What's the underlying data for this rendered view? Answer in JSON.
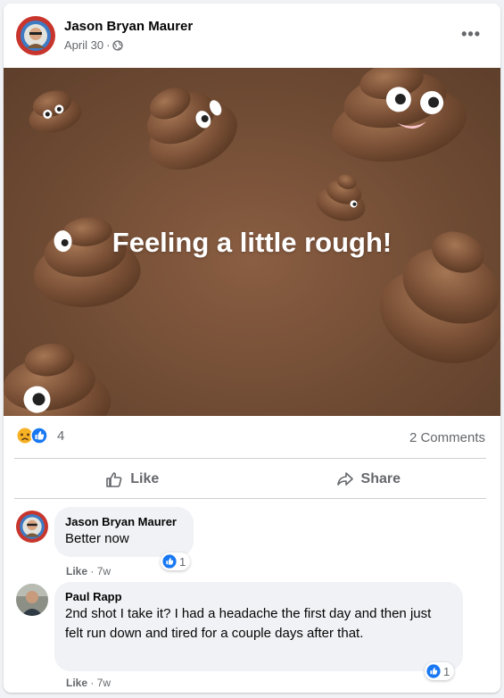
{
  "post": {
    "author": "Jason Bryan Maurer",
    "date": "April 30",
    "separator": "·",
    "audience_icon": "globe-icon",
    "more_label": "•••",
    "image_text": "Feeling a little rough!",
    "reaction_count": "4",
    "comment_count": "2 Comments",
    "reaction_icons": [
      "sad-reaction-icon",
      "like-reaction-icon"
    ]
  },
  "actions": {
    "like_label": "Like",
    "share_label": "Share"
  },
  "comments": [
    {
      "author": "Jason Bryan Maurer",
      "text": "Better now",
      "like_label": "Like",
      "time": "7w",
      "reaction_count": "1"
    },
    {
      "author": "Paul Rapp",
      "text": "2nd shot I take it? I had a headache the first day and then just felt run down and tired for a couple days after that.",
      "like_label": "Like",
      "time": "7w",
      "reaction_count": "1"
    }
  ],
  "colors": {
    "like_blue": "#1877f2",
    "sad_yellow": "#f7b125",
    "text_secondary": "#65676b"
  }
}
